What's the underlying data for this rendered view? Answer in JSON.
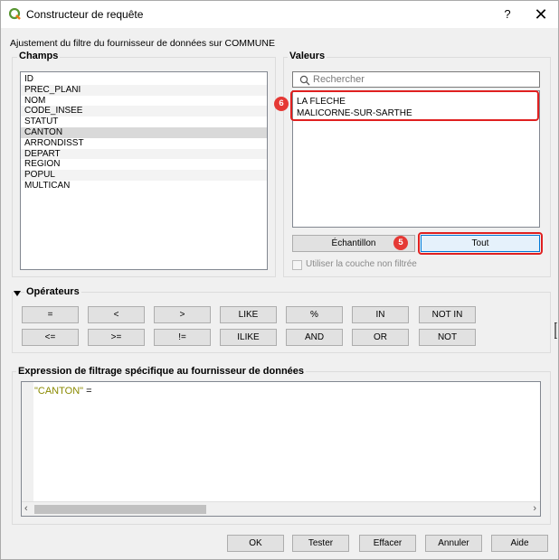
{
  "window": {
    "title": "Constructeur de requête",
    "help": "?",
    "close": "✕"
  },
  "subtitle": "Ajustement du filtre du fournisseur de données sur COMMUNE",
  "fields": {
    "title": "Champs",
    "items": [
      "ID",
      "PREC_PLANI",
      "NOM",
      "CODE_INSEE",
      "STATUT",
      "CANTON",
      "ARRONDISST",
      "DEPART",
      "REGION",
      "POPUL",
      "MULTICAN"
    ],
    "selected": "CANTON"
  },
  "values": {
    "title": "Valeurs",
    "search_placeholder": "Rechercher",
    "items": [
      "LA FLECHE",
      "MALICORNE-SUR-SARTHE"
    ],
    "sample_button": "Échantillon",
    "all_button": "Tout",
    "use_unfiltered_label": "Utiliser la couche non filtrée"
  },
  "badges": {
    "values_list": "6",
    "all_button": "5"
  },
  "operators": {
    "title": "Opérateurs",
    "row1": [
      "=",
      "<",
      ">",
      "LIKE",
      "%",
      "IN",
      "NOT IN"
    ],
    "row2": [
      "<=",
      ">=",
      "!=",
      "ILIKE",
      "AND",
      "OR",
      "NOT"
    ]
  },
  "expression": {
    "title": "Expression de filtrage spécifique au fournisseur de données",
    "field_token": "\"CANTON\"",
    "operator_token": " ="
  },
  "buttons": {
    "ok": "OK",
    "test": "Tester",
    "clear": "Effacer",
    "cancel": "Annuler",
    "help": "Aide"
  },
  "colors": {
    "highlight": "#e02020",
    "accent": "#0078d7",
    "expression_field": "#8a8a00"
  }
}
